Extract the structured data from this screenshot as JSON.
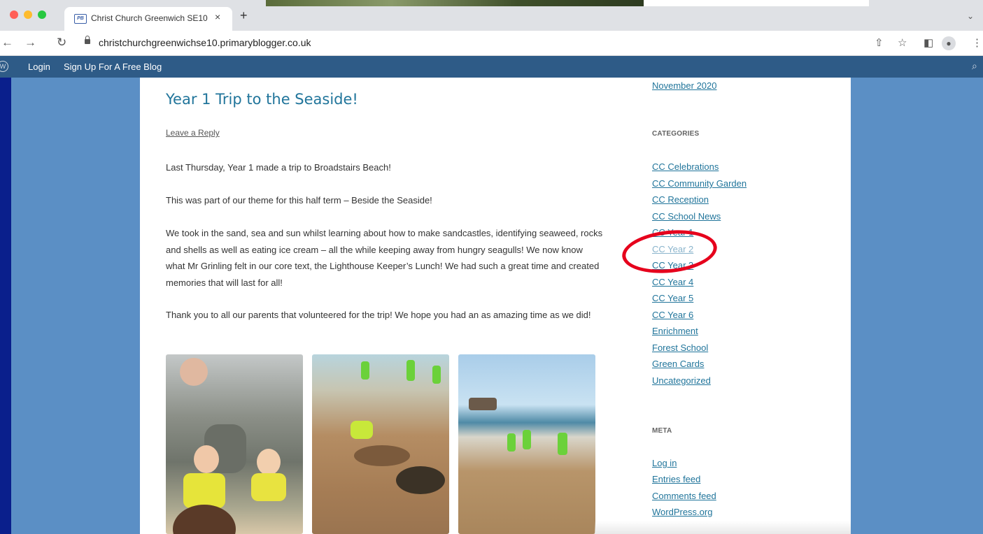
{
  "browser": {
    "tab_title": "Christ Church Greenwich SE10",
    "tab_favicon": "PB",
    "tab_close": "×",
    "new_tab": "+",
    "url": "christchurchgreenwichse10.primaryblogger.co.uk",
    "icons": [
      "back-arrow-icon",
      "forward-arrow-icon",
      "reload-icon",
      "lock-icon",
      "share-icon",
      "star-icon",
      "side-panel-icon",
      "profile-icon",
      "menu-icon"
    ]
  },
  "wp_bar": {
    "login": "Login",
    "signup": "Sign Up For A Free Blog"
  },
  "post": {
    "title": "Year 1 Trip to the Seaside!",
    "leave_reply": "Leave a Reply",
    "paragraphs": [
      "Last Thursday, Year 1 made a trip to Broadstairs Beach!",
      "This was part of our theme for this half term – Beside the Seaside!",
      "We took in the sand, sea and sun whilst learning about how to make sandcastles, identifying seaweed, rocks and shells as well as eating ice cream – all the while keeping away from hungry seagulls! We now know what Mr Grinling felt in our core text, the Lighthouse Keeper’s Lunch! We had such a great time and created memories that will last for all!",
      "Thank you to all our parents that volunteered for the trip! We hope you had an as amazing time as we did!"
    ]
  },
  "sidebar": {
    "archive_month": "November 2020",
    "categories_heading": "CATEGORIES",
    "categories": [
      "CC Celebrations",
      "CC Community Garden",
      "CC Reception",
      "CC School News",
      "CC Year 1",
      "CC Year 2",
      "CC Year 3",
      "CC Year 4",
      "CC Year 5",
      "CC Year 6",
      "Enrichment",
      "Forest School",
      "Green Cards",
      "Uncategorized"
    ],
    "meta_heading": "META",
    "meta": [
      "Log in",
      "Entries feed",
      "Comments feed",
      "WordPress.org"
    ]
  },
  "colors": {
    "link": "#21759b",
    "page_bg": "#5b8fc5",
    "frame": "#0a1f8c",
    "annotation": "#e6001c"
  }
}
